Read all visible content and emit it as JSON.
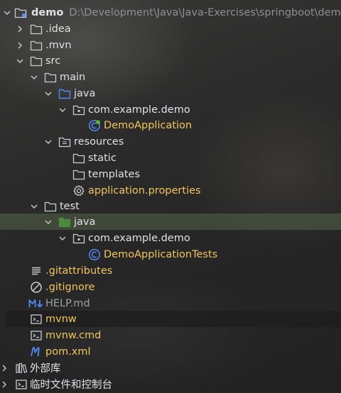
{
  "project": {
    "name": "demo",
    "path": "D:\\Development\\Java\\Java-Exercises\\springboot\\demo"
  },
  "tree": {
    "idea": ".idea",
    "mvn": ".mvn",
    "src": "src",
    "main": "main",
    "main_java": "java",
    "main_package": "com.example.demo",
    "main_class": "DemoApplication",
    "resources": "resources",
    "static": "static",
    "templates": "templates",
    "app_props": "application.properties",
    "test": "test",
    "test_java": "java",
    "test_package": "com.example.demo",
    "test_class": "DemoApplicationTests",
    "gitattributes": ".gitattributes",
    "gitignore": ".gitignore",
    "help": "HELP.md",
    "mvnw": "mvnw",
    "mvnw_cmd": "mvnw.cmd",
    "pom": "pom.xml"
  },
  "footer": {
    "external_libs": "外部库",
    "scratches": "临时文件和控制台"
  },
  "colors": {
    "folder_icon": "#c9ccd1",
    "source_folder_icon": "#548af7",
    "test_folder_icon": "#4e8a3e",
    "class_icon": "#548af7",
    "spring_icon": "#5fb832",
    "app_text": "#f2c55c",
    "selected_row": "#697d5a"
  }
}
